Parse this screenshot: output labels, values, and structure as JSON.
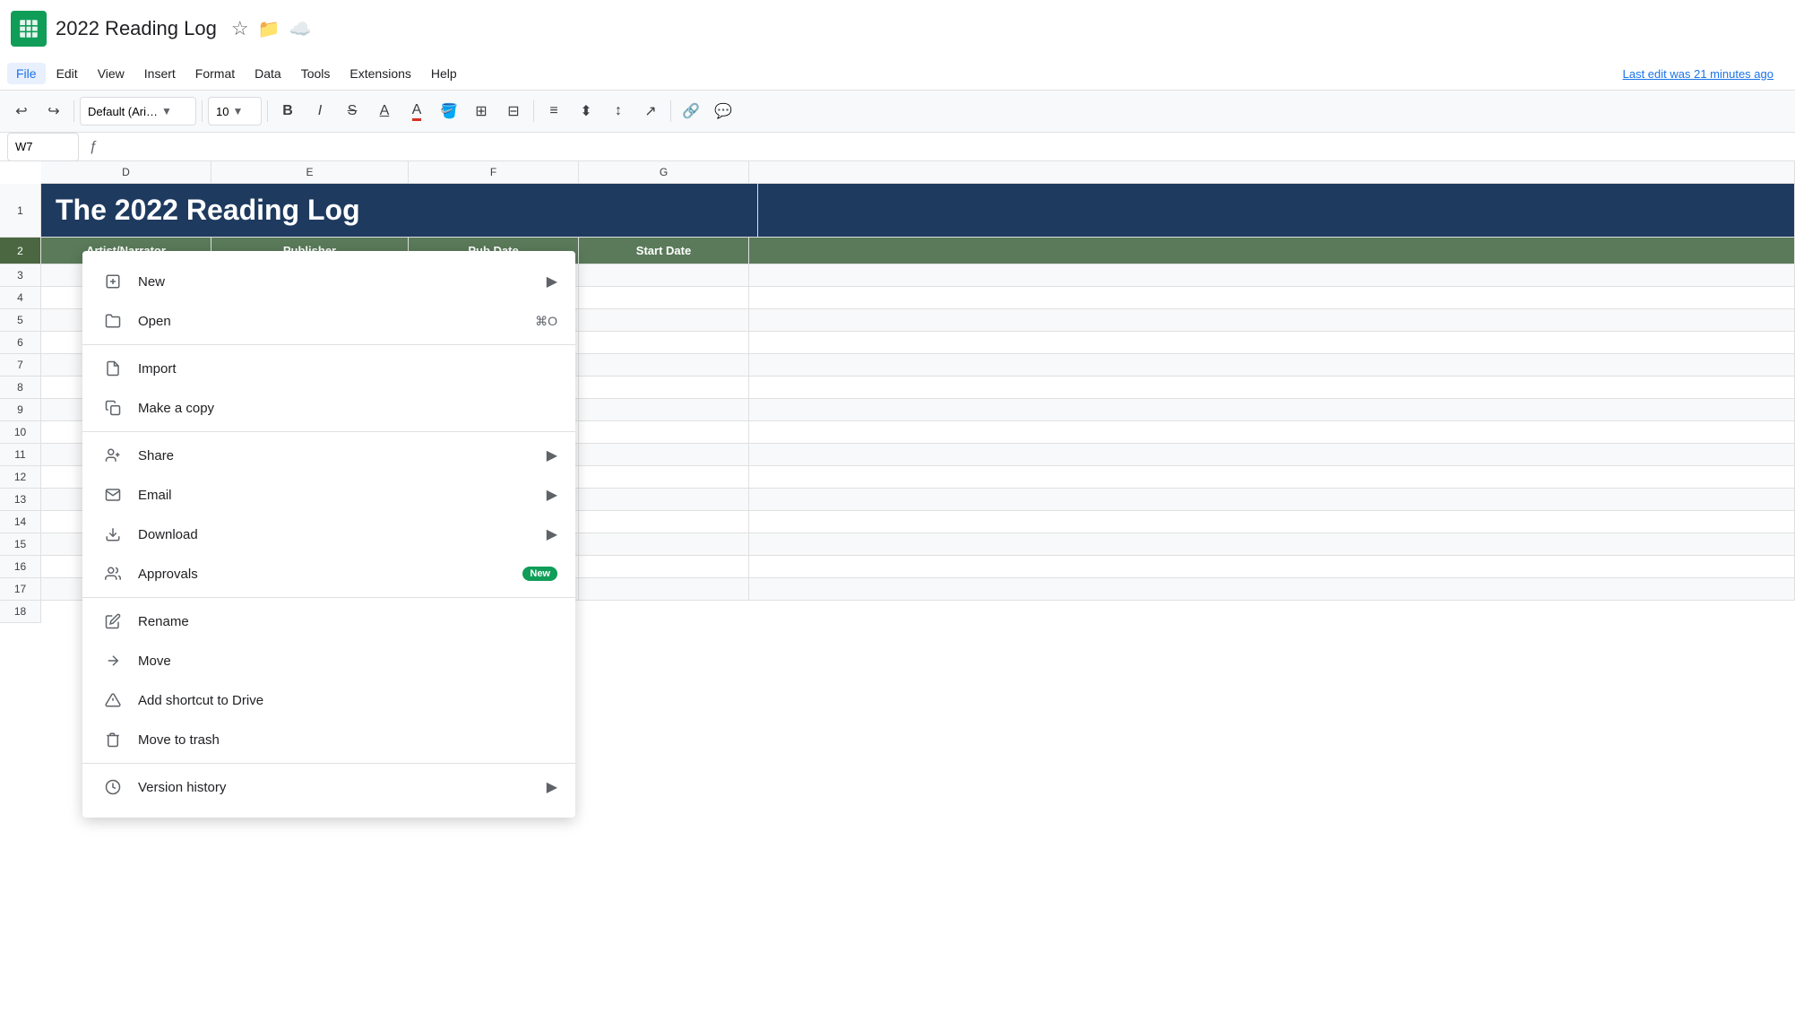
{
  "app": {
    "icon_color": "#0f9d58",
    "title": "2022 Reading Log",
    "last_edit": "Last edit was 21 minutes ago"
  },
  "menubar": {
    "items": [
      {
        "id": "file",
        "label": "File",
        "active": true
      },
      {
        "id": "edit",
        "label": "Edit",
        "active": false
      },
      {
        "id": "view",
        "label": "View",
        "active": false
      },
      {
        "id": "insert",
        "label": "Insert",
        "active": false
      },
      {
        "id": "format",
        "label": "Format",
        "active": false
      },
      {
        "id": "data",
        "label": "Data",
        "active": false
      },
      {
        "id": "tools",
        "label": "Tools",
        "active": false
      },
      {
        "id": "extensions",
        "label": "Extensions",
        "active": false
      },
      {
        "id": "help",
        "label": "Help",
        "active": false
      }
    ]
  },
  "toolbar": {
    "font_name": "Default (Ari…",
    "font_size": "10",
    "cell_ref": "W7"
  },
  "spreadsheet": {
    "title": "The 2022 Reading Log",
    "columns": [
      "D",
      "E",
      "F",
      "G"
    ],
    "col_headers": [
      "Artist/Narrator",
      "Publisher",
      "Pub Date",
      "Start Date"
    ],
    "row_count": 18
  },
  "file_menu": {
    "sections": [
      {
        "items": [
          {
            "id": "new",
            "icon": "➕",
            "label": "New",
            "has_arrow": true,
            "shortcut": ""
          },
          {
            "id": "open",
            "icon": "📂",
            "label": "Open",
            "has_arrow": false,
            "shortcut": "⌘O"
          }
        ]
      },
      {
        "items": [
          {
            "id": "import",
            "icon": "📄",
            "label": "Import",
            "has_arrow": false,
            "shortcut": ""
          },
          {
            "id": "make-copy",
            "icon": "📋",
            "label": "Make a copy",
            "has_arrow": false,
            "shortcut": ""
          }
        ]
      },
      {
        "items": [
          {
            "id": "share",
            "icon": "👤",
            "label": "Share",
            "has_arrow": true,
            "shortcut": ""
          },
          {
            "id": "email",
            "icon": "✉️",
            "label": "Email",
            "has_arrow": true,
            "shortcut": ""
          },
          {
            "id": "download",
            "icon": "⬇️",
            "label": "Download",
            "has_arrow": true,
            "shortcut": ""
          },
          {
            "id": "approvals",
            "icon": "👥",
            "label": "Approvals",
            "has_arrow": false,
            "shortcut": "",
            "badge": "New"
          }
        ]
      },
      {
        "items": [
          {
            "id": "rename",
            "icon": "✏️",
            "label": "Rename",
            "has_arrow": false,
            "shortcut": ""
          },
          {
            "id": "move",
            "icon": "📁",
            "label": "Move",
            "has_arrow": false,
            "shortcut": ""
          },
          {
            "id": "add-shortcut",
            "icon": "🔗",
            "label": "Add shortcut to Drive",
            "has_arrow": false,
            "shortcut": ""
          },
          {
            "id": "move-trash",
            "icon": "🗑️",
            "label": "Move to trash",
            "has_arrow": false,
            "shortcut": ""
          }
        ]
      },
      {
        "items": [
          {
            "id": "version-history",
            "icon": "🕐",
            "label": "Version history",
            "has_arrow": true,
            "shortcut": ""
          }
        ]
      }
    ]
  }
}
